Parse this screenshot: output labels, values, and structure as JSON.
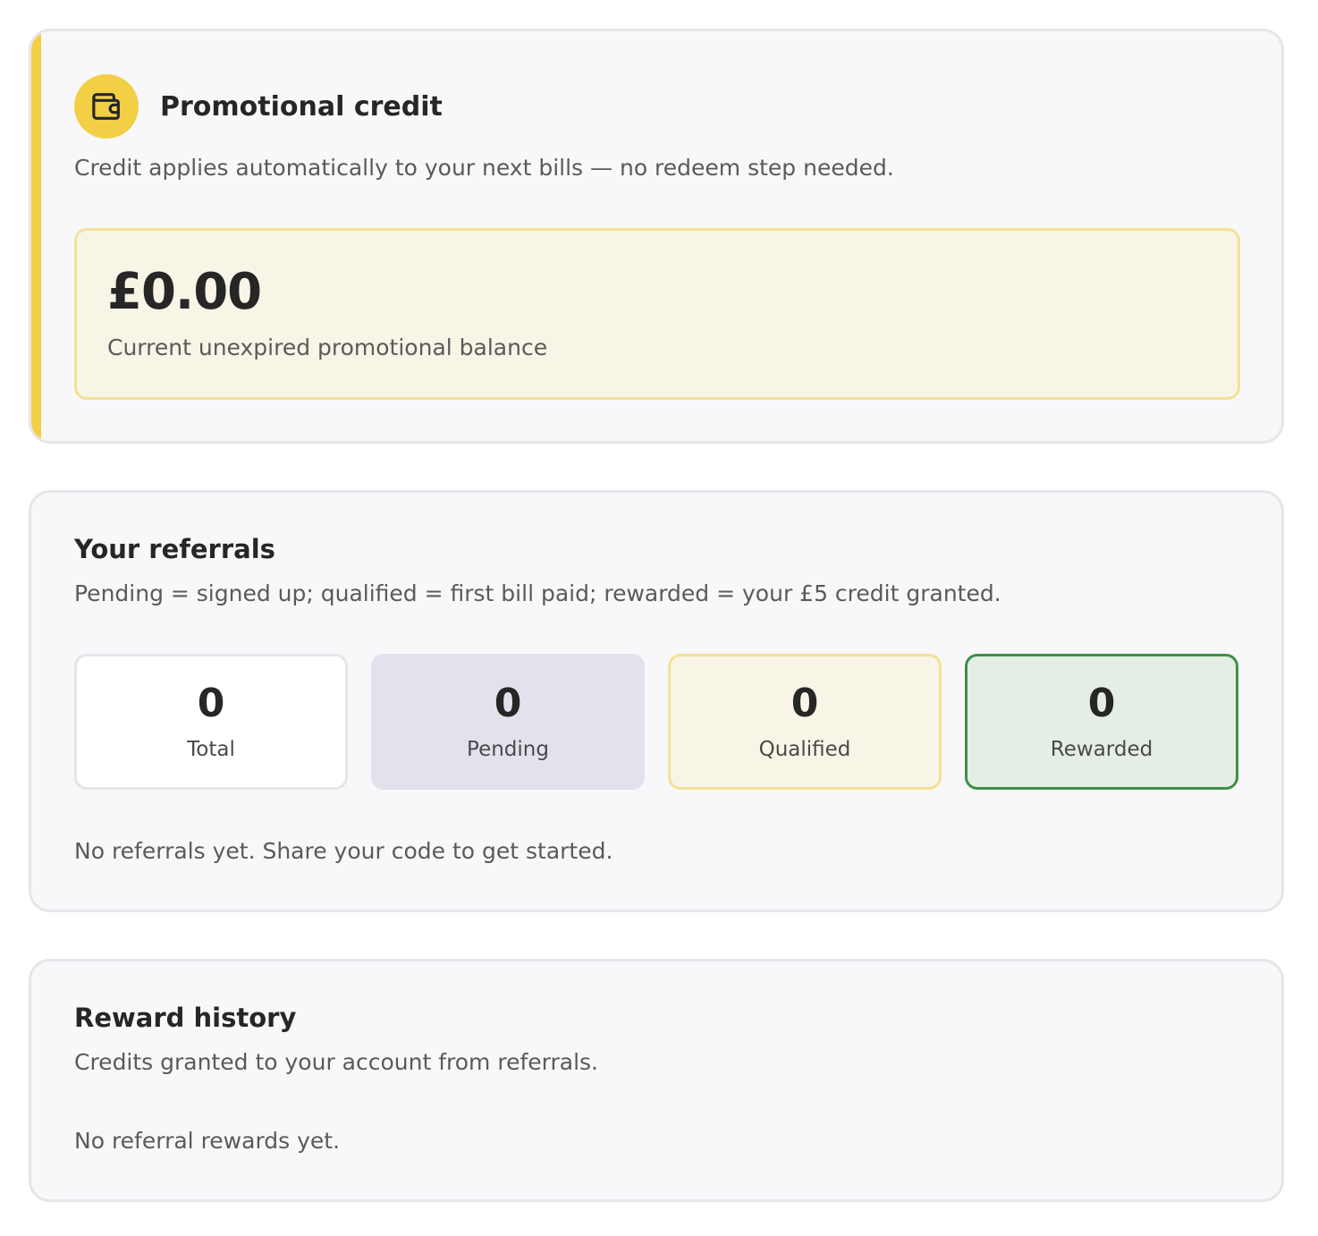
{
  "promotional_credit": {
    "title": "Promotional credit",
    "description": "Credit applies automatically to your next bills — no redeem step needed.",
    "balance": "£0.00",
    "balance_label": "Current unexpired promotional balance",
    "icon": "wallet-icon",
    "accent_color": "#f2cf45"
  },
  "referrals": {
    "title": "Your referrals",
    "description": "Pending = signed up; qualified = first bill paid; rewarded = your £5 credit granted.",
    "stats": [
      {
        "value": "0",
        "label": "Total"
      },
      {
        "value": "0",
        "label": "Pending"
      },
      {
        "value": "0",
        "label": "Qualified"
      },
      {
        "value": "0",
        "label": "Rewarded"
      }
    ],
    "empty_message": "No referrals yet. Share your code to get started."
  },
  "reward_history": {
    "title": "Reward history",
    "description": "Credits granted to your account from referrals.",
    "empty_message": "No referral rewards yet."
  }
}
